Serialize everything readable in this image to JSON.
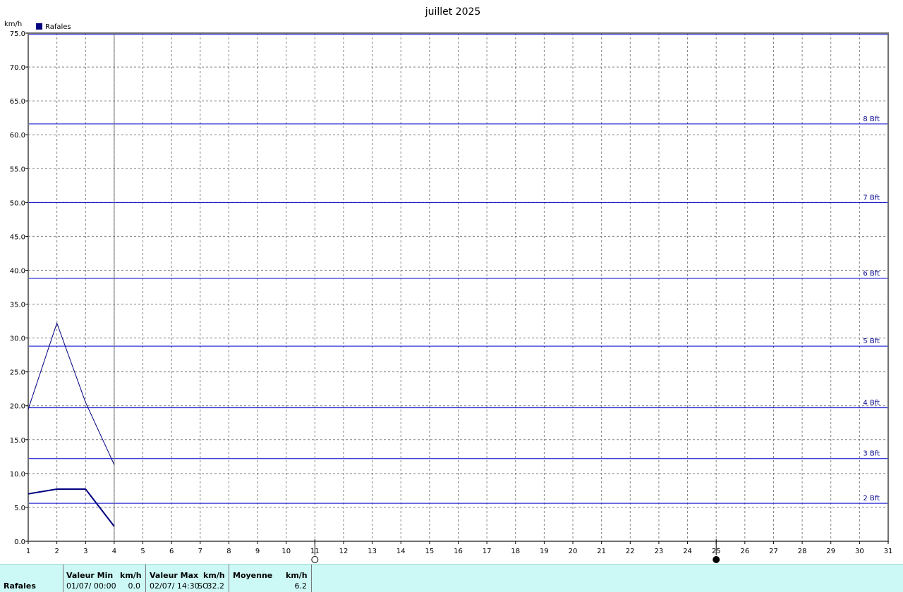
{
  "chart_data": {
    "type": "line",
    "title": "juillet 2025",
    "ylabel": "km/h",
    "x": [
      1,
      2,
      3,
      4
    ],
    "xlim": [
      1,
      31
    ],
    "ylim": [
      0,
      75
    ],
    "xticks": [
      1,
      2,
      3,
      4,
      5,
      6,
      7,
      8,
      9,
      10,
      11,
      12,
      13,
      14,
      15,
      16,
      17,
      18,
      19,
      20,
      21,
      22,
      23,
      24,
      25,
      26,
      27,
      28,
      29,
      30,
      31
    ],
    "yticks": [
      "0.0",
      "5.0",
      "10.0",
      "15.0",
      "20.0",
      "25.0",
      "30.0",
      "35.0",
      "40.0",
      "45.0",
      "50.0",
      "55.0",
      "60.0",
      "65.0",
      "70.0",
      "75.0"
    ],
    "grid": true,
    "legend": {
      "position": "top-left",
      "entries": [
        "Rafales"
      ]
    },
    "series": [
      {
        "name": "Rafales",
        "values": [
          19.5,
          32.2,
          20.5,
          11.3
        ],
        "color": "#000080",
        "width": 1
      },
      {
        "values": [
          7.0,
          7.7,
          7.7,
          2.2
        ],
        "color": "#000080",
        "width": 2
      }
    ],
    "beaufort": [
      {
        "label": "2 Bft",
        "value": 5.6
      },
      {
        "label": "3 Bft",
        "value": 12.2
      },
      {
        "label": "4 Bft",
        "value": 19.7
      },
      {
        "label": "5 Bft",
        "value": 28.8
      },
      {
        "label": "6 Bft",
        "value": 38.8
      },
      {
        "label": "7 Bft",
        "value": 50.0
      },
      {
        "label": "8 Bft",
        "value": 61.6
      }
    ],
    "limit_line": 74.8,
    "current_day": 4,
    "moon_phases": [
      {
        "day": 11,
        "phase": "full-moon"
      },
      {
        "day": 25,
        "phase": "new-moon"
      }
    ]
  },
  "stats": {
    "row_label": "Rafales",
    "min_header": "Valeur Min",
    "min_unit": "km/h",
    "min_date": "01/07/  00:00",
    "min_value": "0.0",
    "max_header": "Valeur Max",
    "max_unit": "km/h",
    "max_date": "02/07/  14:30",
    "max_dir": "SO",
    "max_value": "32.2",
    "avg_header": "Moyenne",
    "avg_unit": "km/h",
    "avg_value": "6.2"
  },
  "colors": {
    "series": "#000080",
    "beaufort": "#0000cc",
    "grid": "#808080",
    "panel_bg": "#ccf8f6"
  }
}
